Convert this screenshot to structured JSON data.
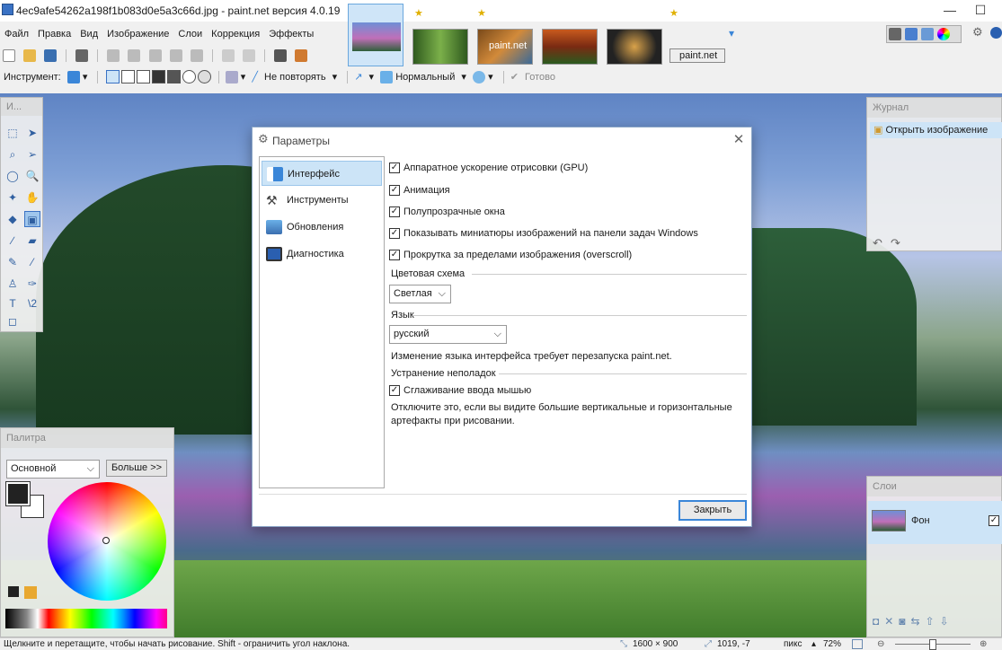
{
  "window": {
    "title": "4ec9afe54262a198f1b083d0e5a3c66d.jpg - paint.net версия 4.0.19",
    "minimize_glyph": "—",
    "maximize_glyph": "☐",
    "close_glyph": "✕"
  },
  "menu": [
    "Файл",
    "Правка",
    "Вид",
    "Изображение",
    "Слои",
    "Коррекция",
    "Эффекты"
  ],
  "thumbnails": {
    "label_paint": "paint.net",
    "label_tab": "paint.net",
    "star": "★",
    "more": "▾"
  },
  "toolbar2": {
    "tool_label": "Инструмент:",
    "repeat_label": "Не повторять",
    "blend_label": "Нормальный",
    "done_label": "Готово"
  },
  "tools_panel": {
    "title": "И..."
  },
  "journal": {
    "title": "Журнал",
    "item": "Открыть изображение"
  },
  "layers": {
    "title": "Слои",
    "layer_name": "Фон"
  },
  "palette": {
    "title": "Палитра",
    "mode": "Основной",
    "more_button": "Больше >>"
  },
  "dialog": {
    "title": "Параметры",
    "nav": [
      "Интерфейс",
      "Инструменты",
      "Обновления",
      "Диагностика"
    ],
    "checkboxes": [
      "Аппаратное ускорение отрисовки (GPU)",
      "Анимация",
      "Полупрозрачные окна",
      "Показывать миниатюры изображений на панели задач Windows",
      "Прокрутка за пределами изображения (overscroll)"
    ],
    "color_scheme_label": "Цветовая схема",
    "color_scheme_value": "Светлая",
    "language_label": "Язык",
    "language_value": "русский",
    "language_note": "Изменение языка интерфейса требует перезапуска paint.net.",
    "troubleshoot_label": "Устранение неполадок",
    "smoothing_label": "Сглаживание ввода мышью",
    "smoothing_note_1": "Отключите это, если вы видите большие вертикальные и горизонтальные",
    "smoothing_note_2": "артефакты при рисовании.",
    "close_button": "Закрыть"
  },
  "status": {
    "hint": "Щелкните и перетащите, чтобы начать рисование. Shift - ограничить угол наклона.",
    "image_size": "1600 × 900",
    "cursor_pos": "1019, -7",
    "units": "пикс",
    "zoom": "72%"
  },
  "colors": {
    "accent": "#3a86d8",
    "selection": "#cde4f7"
  }
}
